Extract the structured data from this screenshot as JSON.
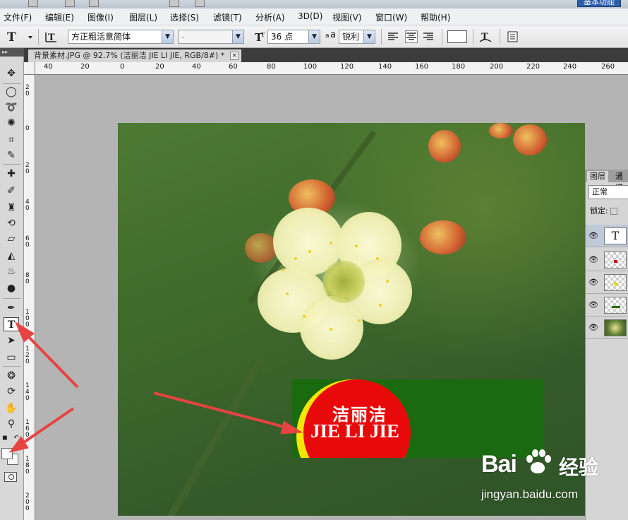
{
  "menu": [
    {
      "label": "文件(F)"
    },
    {
      "label": "编辑(E)"
    },
    {
      "label": "图像(I)"
    },
    {
      "label": "图层(L)"
    },
    {
      "label": "选择(S)"
    },
    {
      "label": "滤镜(T)"
    },
    {
      "label": "分析(A)"
    },
    {
      "label": "3D(D)"
    },
    {
      "label": "视图(V)"
    },
    {
      "label": "窗口(W)"
    },
    {
      "label": "帮助(H)"
    }
  ],
  "workspace_button": "基本功能",
  "options": {
    "font_family": "方正粗活意简体",
    "font_style": "-",
    "font_size": "36 点",
    "aa_label": "a",
    "antialias": "锐利",
    "text_color": "#ffffff"
  },
  "document": {
    "tab_title": "背景素材.JPG @ 92.7% (洁丽洁 JIE LI JIE, RGB/8#) *",
    "close_glyph": "×"
  },
  "ruler_top": {
    "labels": [
      "40",
      "20",
      "0",
      "20",
      "40",
      "60",
      "80",
      "100",
      "120",
      "140",
      "160",
      "180",
      "200",
      "220",
      "240",
      "260"
    ]
  },
  "ruler_left": {
    "labels": [
      "20",
      "0",
      "20",
      "40",
      "60",
      "80",
      "100",
      "120",
      "140",
      "160",
      "180",
      "200"
    ]
  },
  "layers_panel": {
    "tabs": [
      "图层",
      "通道"
    ],
    "blend_mode": "正常",
    "lock_label": "锁定:",
    "text_layer_glyph": "T",
    "eye_glyph": "👁",
    "dot_colors": [
      "#cc0000",
      "#e8d800",
      "#2e6b18"
    ]
  },
  "logo": {
    "chinese": "洁丽洁",
    "english": "JIE LI JIE",
    "colors": {
      "banner": "#1a6b0f",
      "red": "#e80a0a",
      "yellow": "#f3e600"
    }
  },
  "watermark": {
    "logo": "Bai",
    "logo_suffix": "",
    "chinese": "经验",
    "url": "jingyan.baidu.com"
  },
  "annotation_color": "#e84343"
}
